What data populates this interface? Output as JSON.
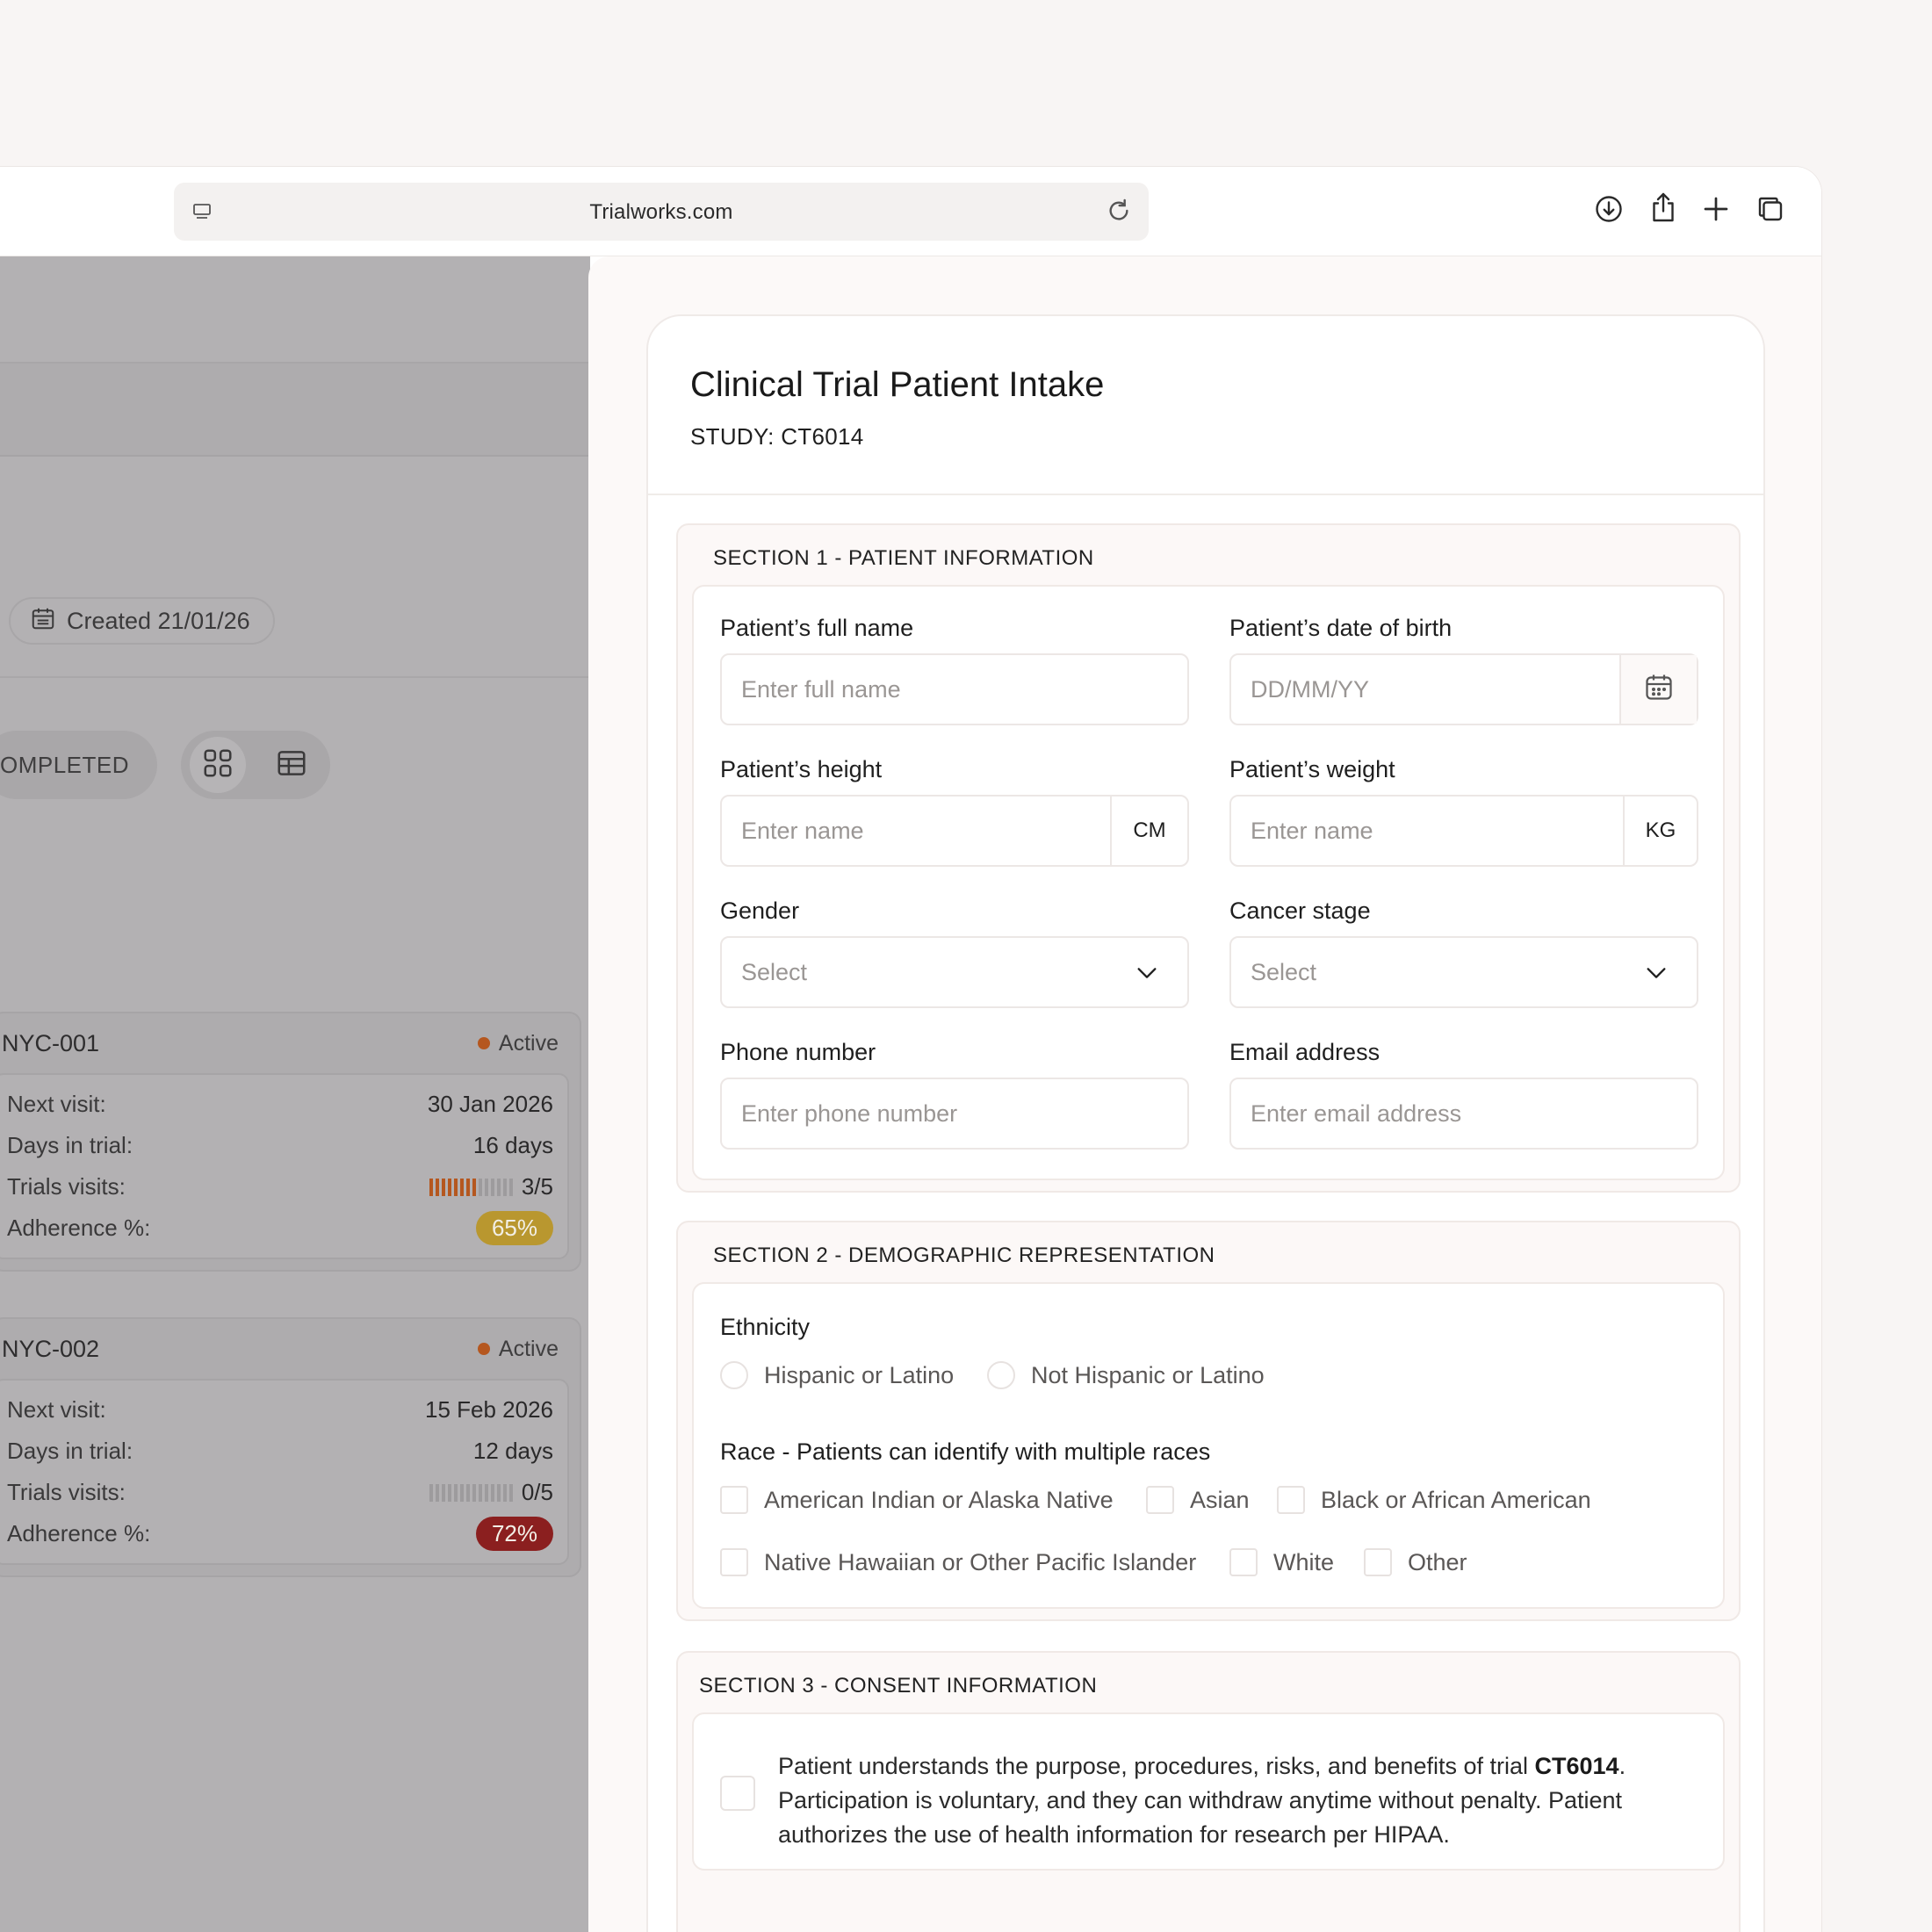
{
  "browser": {
    "url": "Trialworks.com"
  },
  "left_panel": {
    "created_label": "Created 21/01/26",
    "completed_label": "OMPLETED",
    "cards": [
      {
        "id": "NYC-001",
        "status": "Active",
        "next_visit_label": "Next visit:",
        "next_visit": "30 Jan 2026",
        "days_label": "Days in trial:",
        "days": "16 days",
        "visits_label": "Trials visits:",
        "visits": "3/5",
        "visits_filled_fraction": 0.6,
        "adherence_label": "Adherence %:",
        "adherence": "65%",
        "adherence_color": "#b9972f"
      },
      {
        "id": "NYC-002",
        "status": "Active",
        "next_visit_label": "Next visit:",
        "next_visit": "15 Feb 2026",
        "days_label": "Days in trial:",
        "days": "12 days",
        "visits_label": "Trials visits:",
        "visits": "0/5",
        "visits_filled_fraction": 0.0,
        "adherence_label": "Adherence %:",
        "adherence": "72%",
        "adherence_color": "#8b1f1f"
      }
    ]
  },
  "form": {
    "title": "Clinical Trial Patient Intake",
    "study": "STUDY: CT6014",
    "section1": {
      "title": "SECTION 1 - PATIENT INFORMATION",
      "full_name_label": "Patient’s full name",
      "full_name_placeholder": "Enter full name",
      "dob_label": "Patient’s date of birth",
      "dob_placeholder": "DD/MM/YY",
      "height_label": "Patient’s height",
      "height_placeholder": "Enter name",
      "height_unit": "CM",
      "weight_label": "Patient’s weight",
      "weight_placeholder": "Enter name",
      "weight_unit": "KG",
      "gender_label": "Gender",
      "gender_value": "Select",
      "cancer_label": "Cancer stage",
      "cancer_value": "Select",
      "phone_label": "Phone number",
      "phone_placeholder": "Enter phone number",
      "email_label": "Email address",
      "email_placeholder": "Enter email address"
    },
    "section2": {
      "title": "SECTION 2 - DEMOGRAPHIC REPRESENTATION",
      "ethnicity_label": "Ethnicity",
      "ethnicity_options": [
        "Hispanic or Latino",
        "Not Hispanic or Latino"
      ],
      "race_label": "Race - Patients can identify with multiple races",
      "race_options": [
        "American Indian or Alaska Native",
        "Asian",
        "Black or African American",
        "Native Hawaiian or Other Pacific Islander",
        "White",
        "Other"
      ]
    },
    "section3": {
      "title": "SECTION 3 - CONSENT INFORMATION",
      "consent_pre": "Patient understands the purpose, procedures, risks, and benefits of trial ",
      "consent_trial": "CT6014",
      "consent_post": ". Participation is voluntary, and they can withdraw anytime without penalty. Patient authorizes the use of health information for research per HIPAA."
    }
  }
}
